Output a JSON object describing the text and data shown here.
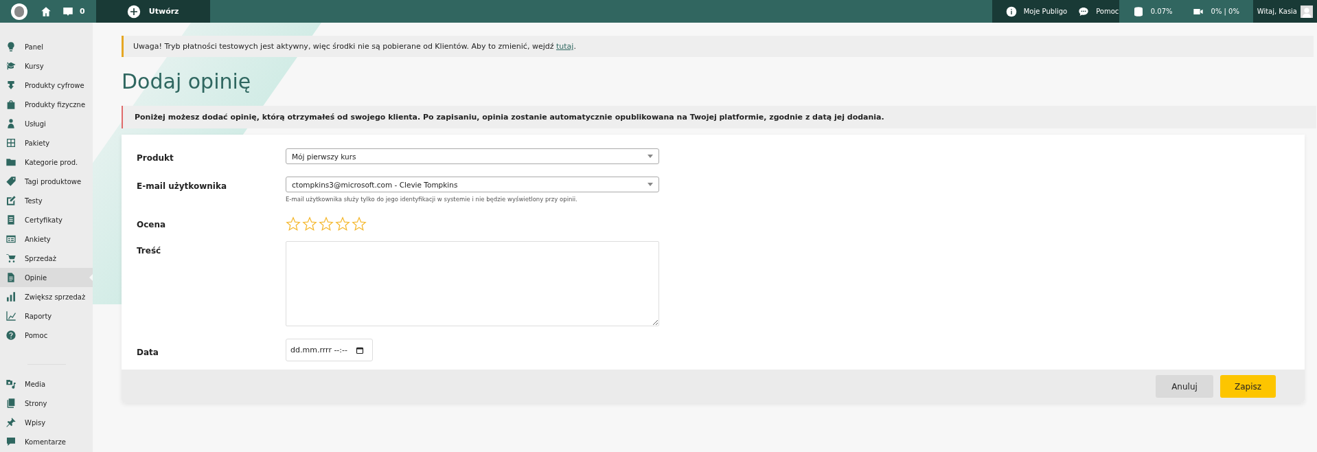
{
  "topbar": {
    "comments_count": "0",
    "create_label": "Utwórz",
    "links": [
      {
        "kind": "info",
        "label": "Moje Publigo"
      },
      {
        "kind": "chat",
        "label": "Pomoc"
      }
    ],
    "stats": [
      {
        "kind": "storage",
        "label": "0.07%"
      },
      {
        "kind": "video",
        "label": "0% | 0%"
      }
    ],
    "greeting": "Witaj, Kasia"
  },
  "sidebar": {
    "items": [
      {
        "label": "Panel",
        "selected": false
      },
      {
        "label": "Kursy",
        "selected": false
      },
      {
        "label": "Produkty cyfrowe",
        "selected": false
      },
      {
        "label": "Produkty fizyczne",
        "selected": false
      },
      {
        "label": "Usługi",
        "selected": false
      },
      {
        "label": "Pakiety",
        "selected": false
      },
      {
        "label": "Kategorie prod.",
        "selected": false
      },
      {
        "label": "Tagi produktowe",
        "selected": false
      },
      {
        "label": "Testy",
        "selected": false
      },
      {
        "label": "Certyfikaty",
        "selected": false
      },
      {
        "label": "Ankiety",
        "selected": false
      },
      {
        "label": "Sprzedaż",
        "selected": false
      },
      {
        "label": "Opinie",
        "selected": true
      },
      {
        "label": "Zwiększ sprzedaż",
        "selected": false
      },
      {
        "label": "Raporty",
        "selected": false
      },
      {
        "label": "Pomoc",
        "selected": false
      }
    ],
    "bottom_items": [
      {
        "label": "Media",
        "selected": false
      },
      {
        "label": "Strony",
        "selected": false
      },
      {
        "label": "Wpisy",
        "selected": false
      },
      {
        "label": "Komentarze",
        "selected": false
      }
    ]
  },
  "notice": {
    "text": "Uwaga! Tryb płatności testowych jest aktywny, więc środki nie są pobierane od Klientów. Aby to zmienić, wejdź ",
    "link": "tutaj",
    "end": "."
  },
  "title": "Dodaj opinię",
  "info": "Poniżej możesz dodać opinię, którą otrzymałeś od swojego klienta. Po zapisaniu, opinia zostanie automatycznie opublikowana na Twojej platformie, zgodnie z datą jej dodania.",
  "form": {
    "fields": [
      {
        "kind": "select",
        "label": "Produkt",
        "value": "Mój pierwszy kurs"
      },
      {
        "kind": "select",
        "label": "E-mail użytkownika",
        "value": "ctompkins3@microsoft.com - Clevie Tompkins",
        "help": "E-mail użytkownika służy tylko do jego identyfikacji w systemie i nie będzie wyświetlony przy opinii."
      },
      {
        "kind": "rating",
        "label": "Ocena",
        "stars": 0
      },
      {
        "kind": "textarea",
        "label": "Treść"
      },
      {
        "kind": "date",
        "label": "Data",
        "placeholder": "dd.mm.rrrr --:--"
      }
    ]
  },
  "buttons": [
    {
      "kind": "secondary",
      "label": "Anuluj"
    },
    {
      "kind": "primary",
      "label": "Zapisz"
    }
  ]
}
